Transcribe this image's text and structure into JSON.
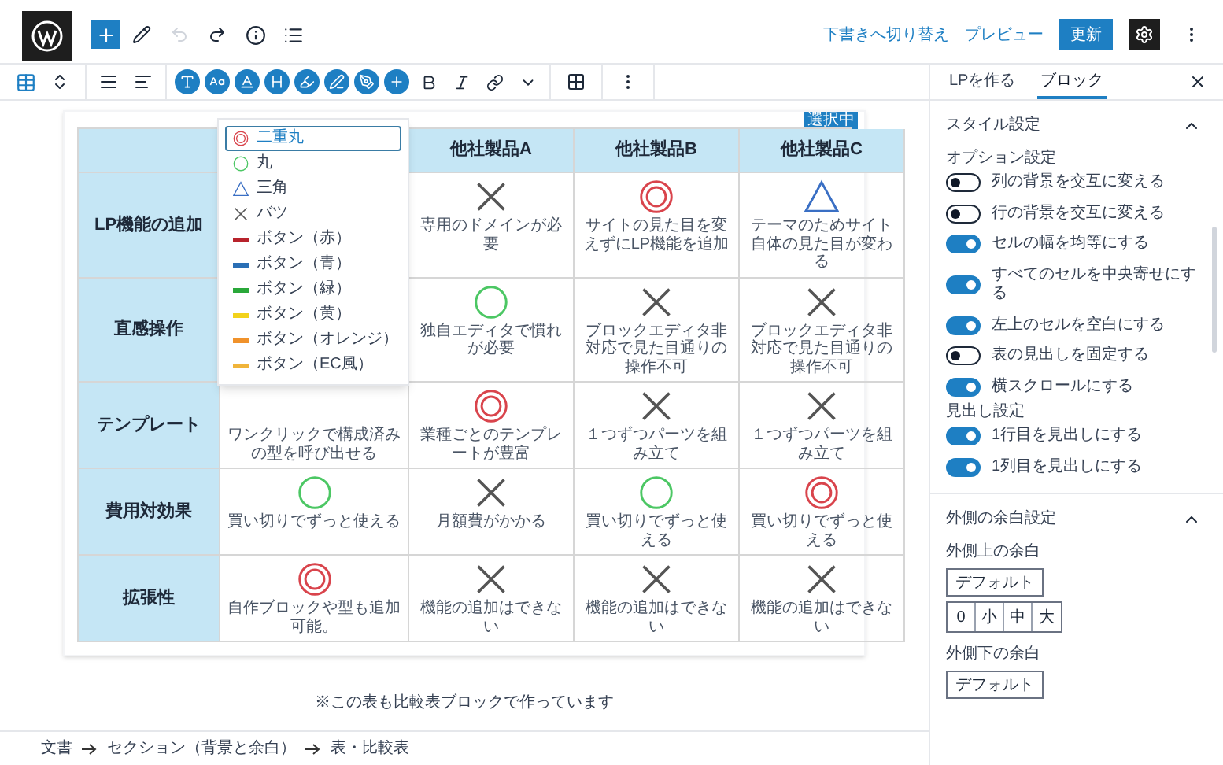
{
  "topbar": {
    "undo_disabled": true,
    "redo_disabled": false,
    "actions": [
      {
        "label": "下書きへ切り替え",
        "kind": "link"
      },
      {
        "label": "プレビュー",
        "kind": "link"
      },
      {
        "label": "更新",
        "kind": "primary"
      }
    ]
  },
  "table": {
    "badge": "選択中",
    "columns": [
      "",
      "他社製品A",
      "他社製品B",
      "他社製品C"
    ],
    "rows": [
      {
        "label": "LP機能の追加",
        "cells": [
          {},
          {
            "kind": "cross",
            "text": "専用のドメインが必要"
          },
          {
            "kind": "double_circle",
            "text": "サイトの見た目を変えずにLP機能を追加"
          },
          {
            "kind": "triangle",
            "text": "テーマのためサイト自体の見た目が変わる"
          }
        ]
      },
      {
        "label": "直感操作",
        "cells": [
          {},
          {
            "kind": "circle",
            "text": "独自エディタで慣れが必要"
          },
          {
            "kind": "cross",
            "text": "ブロックエディタ非対応で見た目通りの操作不可"
          },
          {
            "kind": "cross",
            "text": "ブロックエディタ非対応で見た目通りの操作不可"
          }
        ]
      },
      {
        "label": "テンプレート",
        "cells": [
          {
            "text": "ワンクリックで構成済みの型を呼び出せる"
          },
          {
            "kind": "double_circle",
            "text": "業種ごとのテンプレートが豊富"
          },
          {
            "kind": "cross",
            "text": "１つずつパーツを組み立て"
          },
          {
            "kind": "cross",
            "text": "１つずつパーツを組み立て"
          }
        ]
      },
      {
        "label": "費用対効果",
        "cells": [
          {
            "kind": "circle",
            "text": "買い切りでずっと使える"
          },
          {
            "kind": "cross",
            "text": "月額費がかかる"
          },
          {
            "kind": "circle",
            "text": "買い切りでずっと使える"
          },
          {
            "kind": "double_circle",
            "text": "買い切りでずっと使える"
          }
        ]
      },
      {
        "label": "拡張性",
        "cells": [
          {
            "kind": "double_circle",
            "text": "自作ブロックや型も追加可能。"
          },
          {
            "kind": "cross",
            "text": "機能の追加はできない"
          },
          {
            "kind": "cross",
            "text": "機能の追加はできない"
          },
          {
            "kind": "cross",
            "text": "機能の追加はできない"
          }
        ]
      }
    ]
  },
  "dropdown": {
    "items": [
      {
        "label": "二重丸",
        "kind": "double_circle",
        "selected": true
      },
      {
        "label": "丸",
        "kind": "circle",
        "selected": false
      },
      {
        "label": "三角",
        "kind": "triangle",
        "selected": false
      },
      {
        "label": "バツ",
        "kind": "cross",
        "selected": false
      },
      {
        "label": "ボタン（赤）",
        "kind": "bar",
        "color": "#b8232c",
        "selected": false
      },
      {
        "label": "ボタン（青）",
        "kind": "bar",
        "color": "#2a6fb5",
        "selected": false
      },
      {
        "label": "ボタン（緑）",
        "kind": "bar",
        "color": "#2aa83a",
        "selected": false
      },
      {
        "label": "ボタン（黄）",
        "kind": "bar",
        "color": "#f2d21b",
        "selected": false
      },
      {
        "label": "ボタン（オレンジ）",
        "kind": "bar",
        "color": "#f0922b",
        "selected": false
      },
      {
        "label": "ボタン（EC風）",
        "kind": "bar",
        "color": "#f0b43a",
        "selected": false
      }
    ]
  },
  "caption": "※この表も比較表ブロックで作っています",
  "breadcrumb": [
    "文書",
    "セクション（背景と余白）",
    "表・比較表"
  ],
  "sidebar": {
    "tabs": [
      {
        "label": "LPを作る",
        "selected": false
      },
      {
        "label": "ブロック",
        "selected": true
      }
    ],
    "style_section": {
      "title": "スタイル設定",
      "expanded": true,
      "groups": [
        {
          "label": "オプション設定",
          "toggles": [
            {
              "label": "列の背景を交互に変える",
              "on": false
            },
            {
              "label": "行の背景を交互に変える",
              "on": false
            },
            {
              "label": "セルの幅を均等にする",
              "on": true
            },
            {
              "label": "すべてのセルを中央寄せにする",
              "on": true
            },
            {
              "label": "左上のセルを空白にする",
              "on": true
            },
            {
              "label": "表の見出しを固定する",
              "on": false
            },
            {
              "label": "横スクロールにする",
              "on": true
            }
          ]
        },
        {
          "label": "見出し設定",
          "toggles": [
            {
              "label": "1行目を見出しにする",
              "on": true
            },
            {
              "label": "1列目を見出しにする",
              "on": true
            }
          ]
        }
      ]
    },
    "margin_section": {
      "title": "外側の余白設定",
      "expanded": true,
      "fields": [
        {
          "label": "外側上の余白",
          "button": "デフォルト",
          "options": [
            "0",
            "小",
            "中",
            "大"
          ]
        },
        {
          "label": "外側下の余白",
          "button": "デフォルト"
        }
      ]
    }
  }
}
